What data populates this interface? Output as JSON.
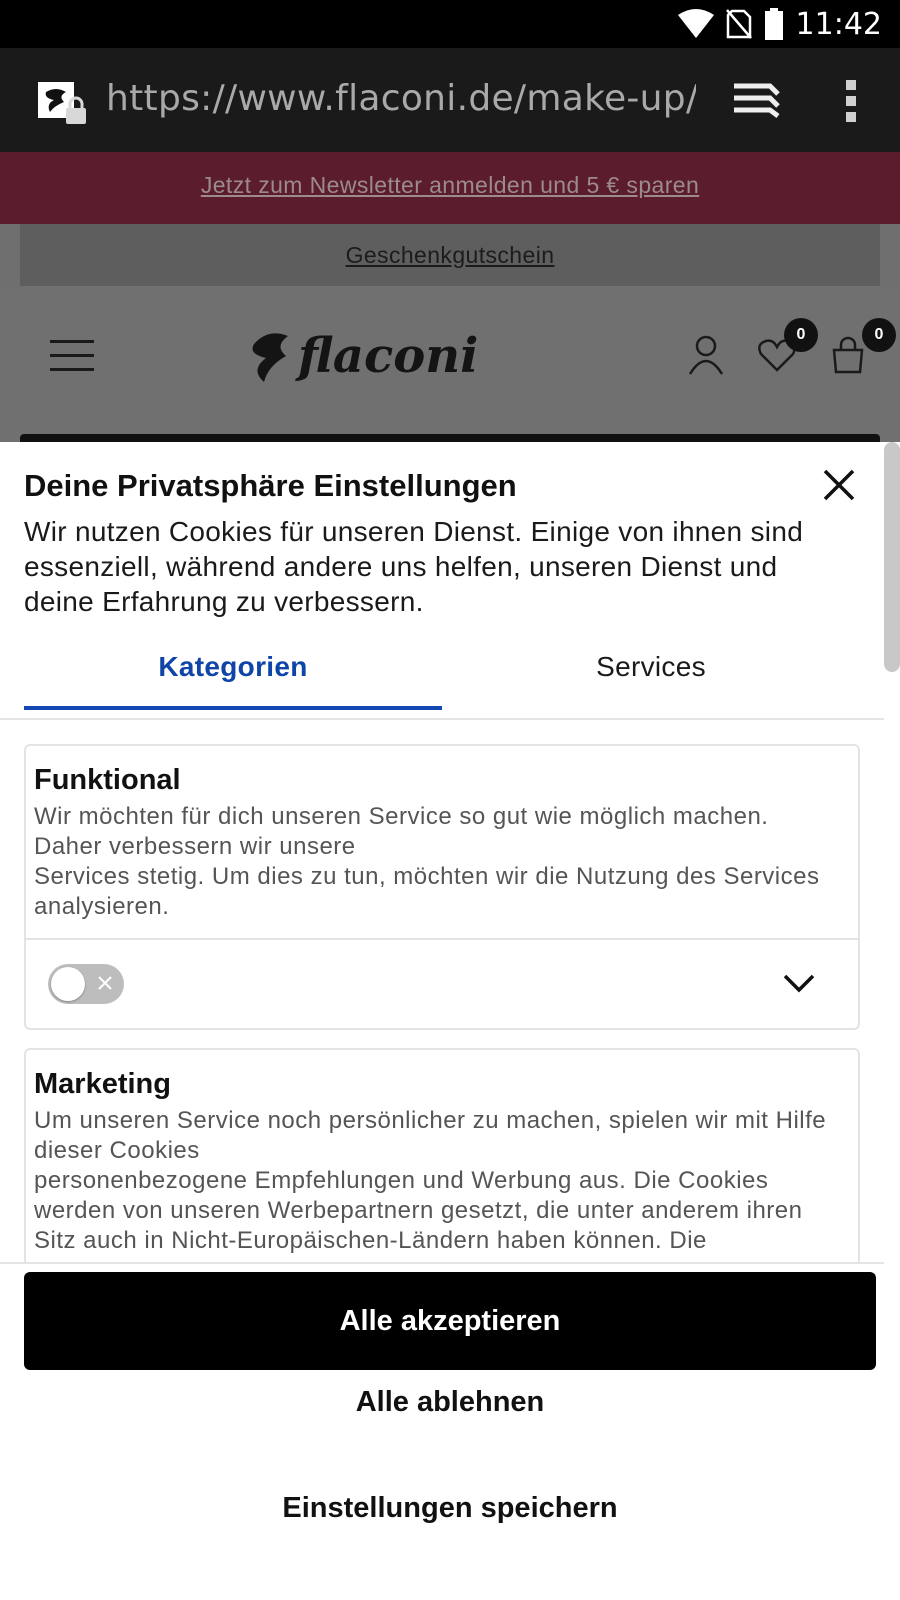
{
  "status_bar": {
    "time": "11:42",
    "icons": [
      "wifi-icon",
      "no-sim-icon",
      "battery-icon"
    ]
  },
  "browser": {
    "url": "https://www.flaconi.de/make-up/bel",
    "icons": [
      "site-lock-icon",
      "tabs-icon",
      "overflow-menu-icon"
    ]
  },
  "page": {
    "newsletter_link": "Jetzt zum Newsletter anmelden und 5 € sparen",
    "voucher_link": "Geschenkgutschein",
    "wishlist_count": "0",
    "cart_count": "0",
    "brand": "flaconi",
    "colors": {
      "newsletter_bg": "#5b1d2c",
      "overlay": "#6f6f6f"
    }
  },
  "consent": {
    "title": "Deine Privatsphäre Einstellungen",
    "description": "Wir nutzen Cookies für unseren Dienst. Einige von ihnen sind essenziell, während andere uns helfen, unseren Dienst und deine Erfahrung zu verbessern.",
    "tabs": [
      {
        "label": "Kategorien",
        "active": true
      },
      {
        "label": "Services",
        "active": false
      }
    ],
    "accent_color": "#1548b3",
    "categories": [
      {
        "title": "Funktional",
        "text": "Wir möchten für dich unseren Service so gut wie möglich machen. Daher verbessern wir unsere\nServices stetig. Um dies zu tun, möchten wir die Nutzung des Services analysieren.",
        "enabled": false
      },
      {
        "title": "Marketing",
        "text": "Um unseren Service noch persönlicher zu machen, spielen wir mit Hilfe dieser Cookies\npersonenbezogene Empfehlungen und Werbung aus. Die Cookies werden von unseren Werbepartnern gesetzt, die unter anderem ihren Sitz auch in Nicht-Europäischen-Ländern haben können. Die"
      }
    ],
    "buttons": {
      "accept_all": "Alle akzeptieren",
      "reject_all": "Alle ablehnen",
      "save_settings": "Einstellungen speichern"
    }
  }
}
